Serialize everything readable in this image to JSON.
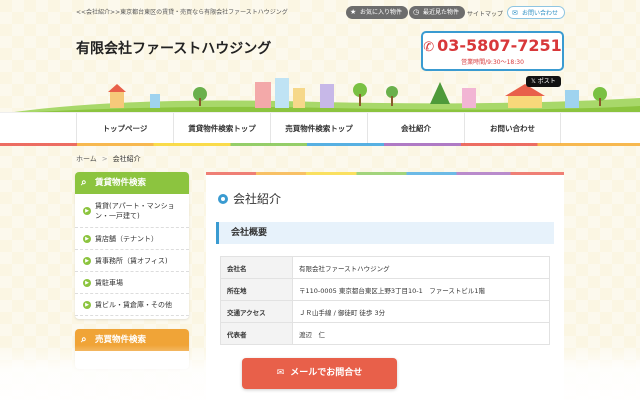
{
  "topbar": {
    "breadcrumb": "<<会社紹介>>東京都台東区の賃貸・売買なら有限会社ファーストハウジング",
    "favorites_label": "お気に入り物件",
    "recent_label": "最近見た物件",
    "sitemap_label": "サイトマップ",
    "contact_label": "お問い合わせ"
  },
  "header": {
    "company_name": "有限会社ファーストハウジング",
    "phone": "03-5807-7251",
    "hours": "営業時間/9:30〜18:30",
    "post_label": "ポスト"
  },
  "nav": {
    "items": [
      {
        "label": "トップページ"
      },
      {
        "label": "賃貸物件検索トップ"
      },
      {
        "label": "売買物件検索トップ"
      },
      {
        "label": "会社紹介"
      },
      {
        "label": "お問い合わせ"
      }
    ]
  },
  "crumb": {
    "home": "ホーム",
    "separator": ">",
    "current": "会社紹介"
  },
  "sidebar": {
    "rent_title": "賃貸物件検索",
    "rent_items": [
      {
        "label": "賃貸(アパート・マンション・一戸建て)"
      },
      {
        "label": "賃店舗（テナント）"
      },
      {
        "label": "賃事務所（賃オフィス)"
      },
      {
        "label": "賃駐車場"
      },
      {
        "label": "賃ビル・賃倉庫・その他"
      }
    ],
    "sale_title": "売買物件検索"
  },
  "main": {
    "page_title": "会社紹介",
    "section_title": "会社概要",
    "rows": [
      {
        "key": "会社名",
        "value": "有限会社ファーストハウジング"
      },
      {
        "key": "所在地",
        "value": "〒110-0005 東京都台東区上野3丁目10-1　ファーストビル1階"
      },
      {
        "key": "交通アクセス",
        "value": "ＪＲ山手線 / 御徒町 徒歩 3分"
      },
      {
        "key": "代表者",
        "value": "渡辺　仁"
      }
    ]
  },
  "cta": {
    "mail_label": "メールでお問合せ"
  },
  "colors": {
    "accent_blue": "#3a9bd1",
    "phone_red": "#d8383a",
    "rent_green": "#8cc43f",
    "sale_orange": "#f0a437",
    "cta_red": "#e8604a"
  }
}
